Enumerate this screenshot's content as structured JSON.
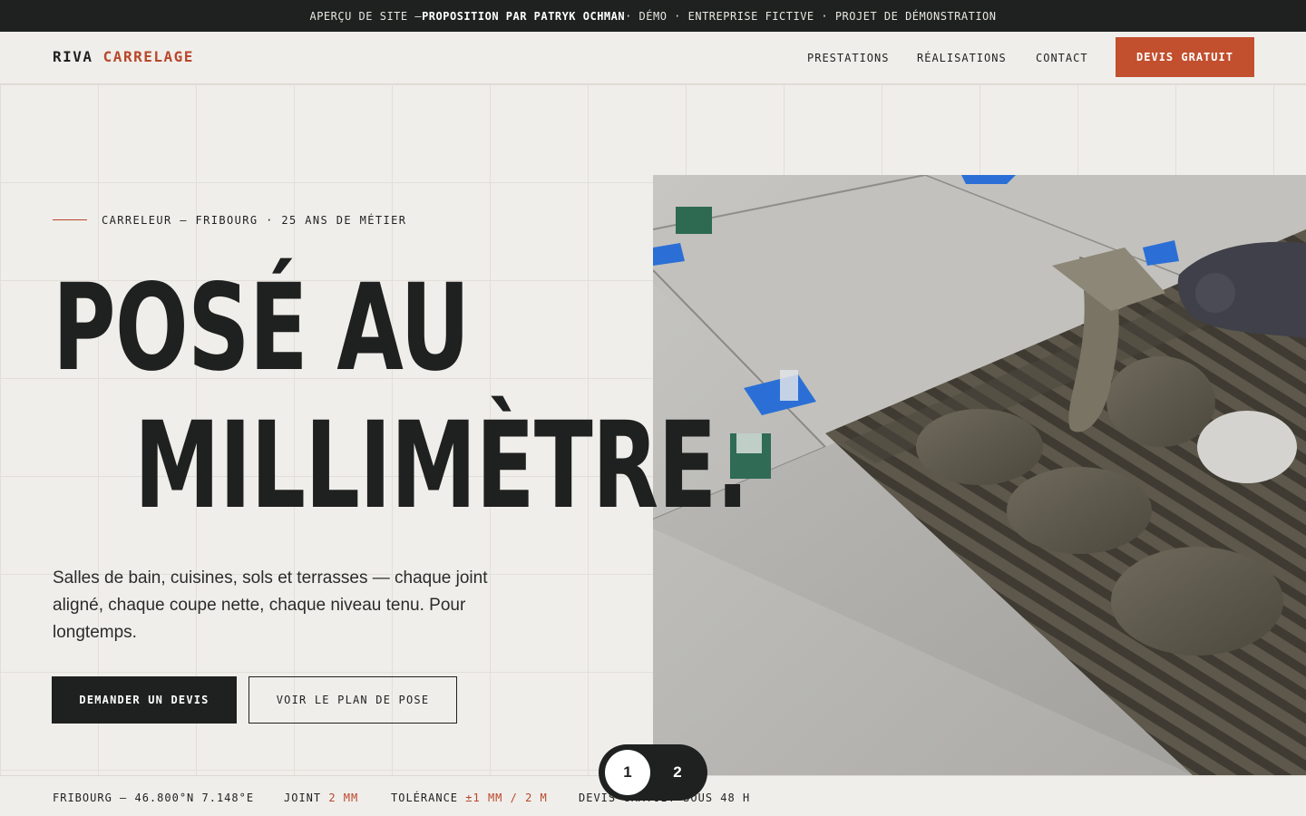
{
  "banner": {
    "part1": "APERÇU DE SITE — ",
    "part2": "PROPOSITION PAR PATRYK OCHMAN",
    "part3": " · DÉMO · ENTREPRISE FICTIVE · PROJET DE DÉMONSTRATION"
  },
  "header": {
    "logo_main": "RIVA",
    "logo_accent": "CARRELAGE",
    "nav": [
      "PRESTATIONS",
      "RÉALISATIONS",
      "CONTACT"
    ],
    "cta": "DEVIS GRATUIT"
  },
  "hero": {
    "eyebrow": "CARRELEUR — FRIBOURG · 25 ANS DE MÉTIER",
    "headline_line1": "POSÉ AU",
    "headline_line2": "MILLIMÈTRE.",
    "lede": "Salles de bain, cuisines, sols et terrasses — chaque joint aligné, chaque coupe nette, chaque niveau tenu. Pour longtemps.",
    "primary_button": "DEMANDER UN DEVIS",
    "secondary_button": "VOIR LE PLAN DE POSE"
  },
  "strip": {
    "location": "FRIBOURG — 46.800°N 7.148°E",
    "joint_label": "JOINT",
    "joint_value": "2 MM",
    "tolerance_label": "TOLÉRANCE",
    "tolerance_value": "±1 MM / 2 M",
    "devis": "DEVIS GRATUIT SOUS 48 H"
  },
  "pager": {
    "pages": [
      "1",
      "2"
    ],
    "active": "1"
  },
  "colors": {
    "accent": "#c24f2e",
    "dark": "#1f2120",
    "background": "#f0eeea"
  }
}
